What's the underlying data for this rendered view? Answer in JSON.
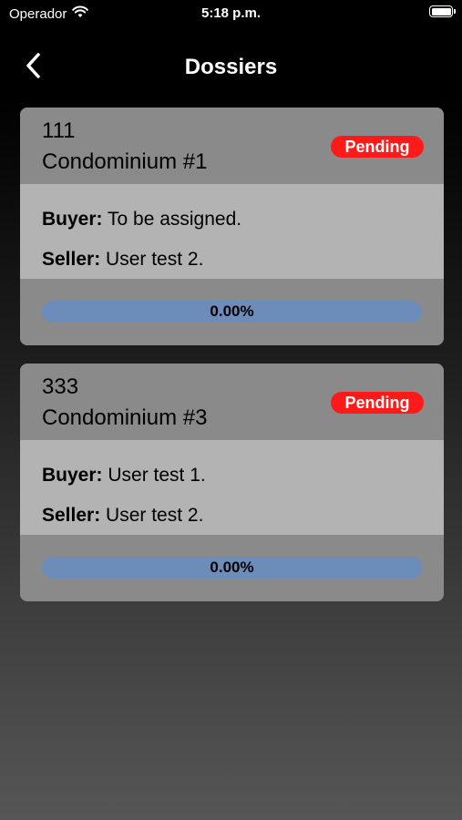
{
  "status_bar": {
    "carrier": "Operador",
    "time": "5:18 p.m."
  },
  "nav": {
    "title": "Dossiers"
  },
  "dossiers": [
    {
      "code": "111",
      "name": "Condominium #1",
      "status": "Pending",
      "buyer_label": "Buyer:",
      "buyer": "To be assigned.",
      "seller_label": "Seller:",
      "seller": "User test 2.",
      "progress_text": "0.00%",
      "progress": 0
    },
    {
      "code": "333",
      "name": "Condominium #3",
      "status": "Pending",
      "buyer_label": "Buyer:",
      "buyer": "User test 1.",
      "seller_label": "Seller:",
      "seller": "User test 2.",
      "progress_text": "0.00%",
      "progress": 0
    }
  ],
  "colors": {
    "badge": "#ff1a1a",
    "progress_track": "#6c8cba",
    "card_header": "#8a8a8a",
    "card_body": "#b3b3b3"
  },
  "icons": {
    "back": "chevron-left-icon",
    "wifi": "wifi-icon",
    "battery": "battery-icon"
  }
}
